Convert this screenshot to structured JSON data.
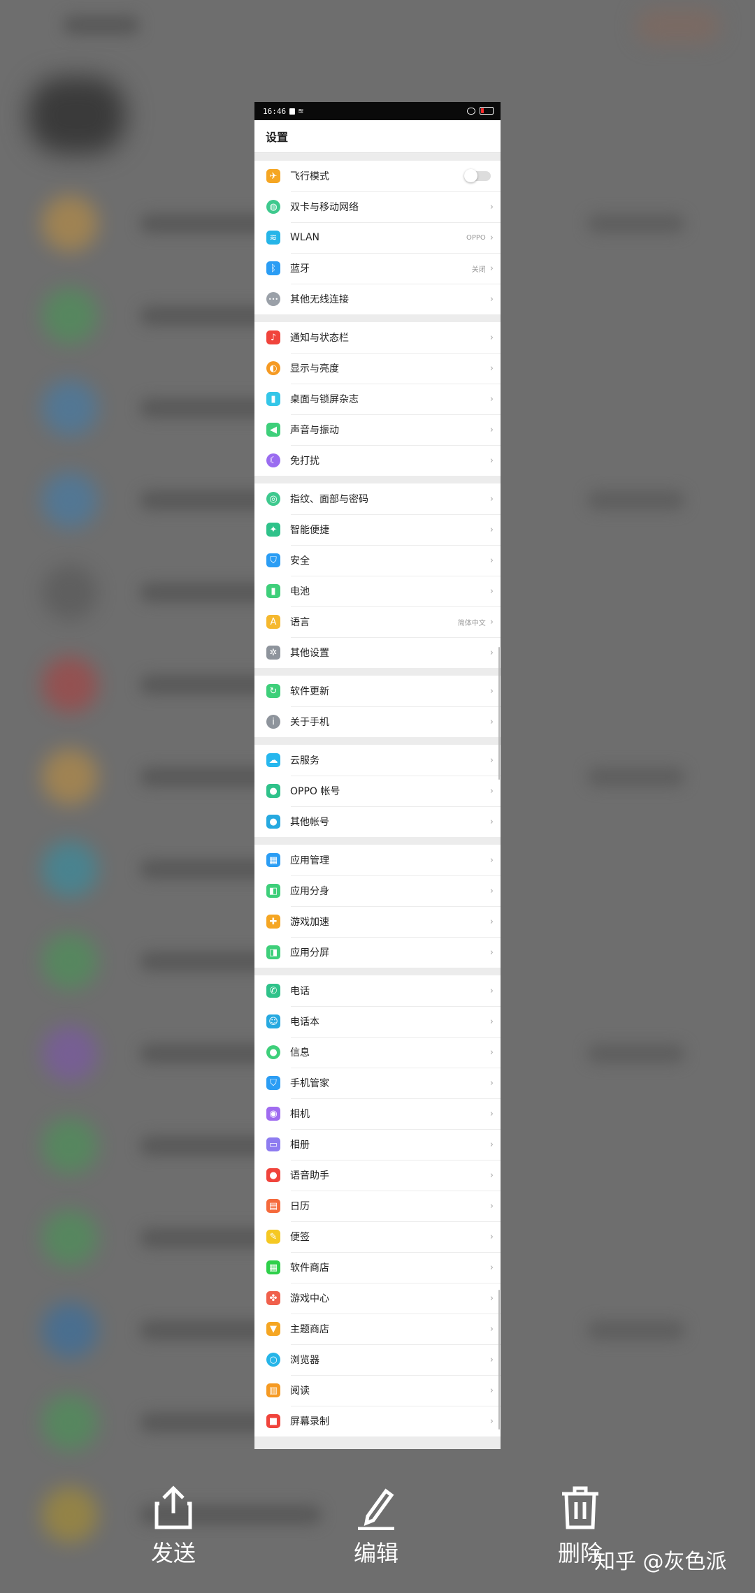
{
  "status_bar": {
    "time": "16:46"
  },
  "header": {
    "title": "设置"
  },
  "groups": [
    {
      "items": [
        {
          "label": "飞行模式",
          "icon": "airplane-icon",
          "color": "#f5a623",
          "toggle": true
        },
        {
          "label": "双卡与移动网络",
          "icon": "globe-icon",
          "color": "#3ec98e"
        },
        {
          "label": "WLAN",
          "icon": "wifi-icon",
          "color": "#26b5e8",
          "value": "OPPO"
        },
        {
          "label": "蓝牙",
          "icon": "bluetooth-icon",
          "color": "#2b9df4",
          "value": "关闭"
        },
        {
          "label": "其他无线连接",
          "icon": "dots-icon",
          "color": "#9aa0a8"
        }
      ]
    },
    {
      "items": [
        {
          "label": "通知与状态栏",
          "icon": "bell-icon",
          "color": "#f0443c"
        },
        {
          "label": "显示与亮度",
          "icon": "brightness-icon",
          "color": "#f59a23"
        },
        {
          "label": "桌面与锁屏杂志",
          "icon": "tablet-icon",
          "color": "#34c6e8"
        },
        {
          "label": "声音与振动",
          "icon": "speaker-icon",
          "color": "#3ecf7a"
        },
        {
          "label": "免打扰",
          "icon": "moon-icon",
          "color": "#9a6cf0"
        }
      ]
    },
    {
      "items": [
        {
          "label": "指纹、面部与密码",
          "icon": "fingerprint-icon",
          "color": "#3ec98e"
        },
        {
          "label": "智能便捷",
          "icon": "smart-icon",
          "color": "#2fc28a"
        },
        {
          "label": "安全",
          "icon": "shield-icon",
          "color": "#2b9df4"
        },
        {
          "label": "电池",
          "icon": "battery-icon",
          "color": "#3ecf7a"
        },
        {
          "label": "语言",
          "icon": "language-icon",
          "color": "#f5b82e",
          "value": "简体中文"
        },
        {
          "label": "其他设置",
          "icon": "gear-icon",
          "color": "#8e949c"
        }
      ]
    },
    {
      "items": [
        {
          "label": "软件更新",
          "icon": "update-icon",
          "color": "#3ecf7a"
        },
        {
          "label": "关于手机",
          "icon": "info-icon",
          "color": "#8e949c"
        }
      ]
    },
    {
      "items": [
        {
          "label": "云服务",
          "icon": "cloud-icon",
          "color": "#27b7ee"
        },
        {
          "label": "OPPO 帐号",
          "icon": "user-icon",
          "color": "#2fc28a"
        },
        {
          "label": "其他帐号",
          "icon": "users-icon",
          "color": "#26a9e0"
        }
      ]
    },
    {
      "items": [
        {
          "label": "应用管理",
          "icon": "apps-icon",
          "color": "#2b9df4"
        },
        {
          "label": "应用分身",
          "icon": "clone-icon",
          "color": "#3ecf7a"
        },
        {
          "label": "游戏加速",
          "icon": "gamepad-icon",
          "color": "#f5a623"
        },
        {
          "label": "应用分屏",
          "icon": "split-icon",
          "color": "#3ecf7a"
        }
      ]
    },
    {
      "items": [
        {
          "label": "电话",
          "icon": "phone-icon",
          "color": "#2fc28a"
        },
        {
          "label": "电话本",
          "icon": "contacts-icon",
          "color": "#26a9e0"
        },
        {
          "label": "信息",
          "icon": "message-icon",
          "color": "#3ecf7a"
        },
        {
          "label": "手机管家",
          "icon": "guard-icon",
          "color": "#2b9df4"
        },
        {
          "label": "相机",
          "icon": "camera-icon",
          "color": "#a06cf0"
        },
        {
          "label": "相册",
          "icon": "gallery-icon",
          "color": "#8e7cf0"
        },
        {
          "label": "语音助手",
          "icon": "mic-icon",
          "color": "#f0443c"
        },
        {
          "label": "日历",
          "icon": "calendar-icon",
          "color": "#f56a3c"
        },
        {
          "label": "便签",
          "icon": "note-icon",
          "color": "#f5c823"
        },
        {
          "label": "软件商店",
          "icon": "store-icon",
          "color": "#2fd04a"
        },
        {
          "label": "游戏中心",
          "icon": "pinwheel-icon",
          "color": "#f0604c"
        },
        {
          "label": "主题商店",
          "icon": "brush-icon",
          "color": "#f5a623"
        },
        {
          "label": "浏览器",
          "icon": "browser-icon",
          "color": "#26b5e8"
        },
        {
          "label": "阅读",
          "icon": "book-icon",
          "color": "#f59a23"
        },
        {
          "label": "屏幕录制",
          "icon": "record-icon",
          "color": "#f0443c"
        }
      ]
    }
  ],
  "actions": {
    "send": "发送",
    "edit": "编辑",
    "delete": "删除"
  },
  "watermark": "知乎 @灰色派"
}
